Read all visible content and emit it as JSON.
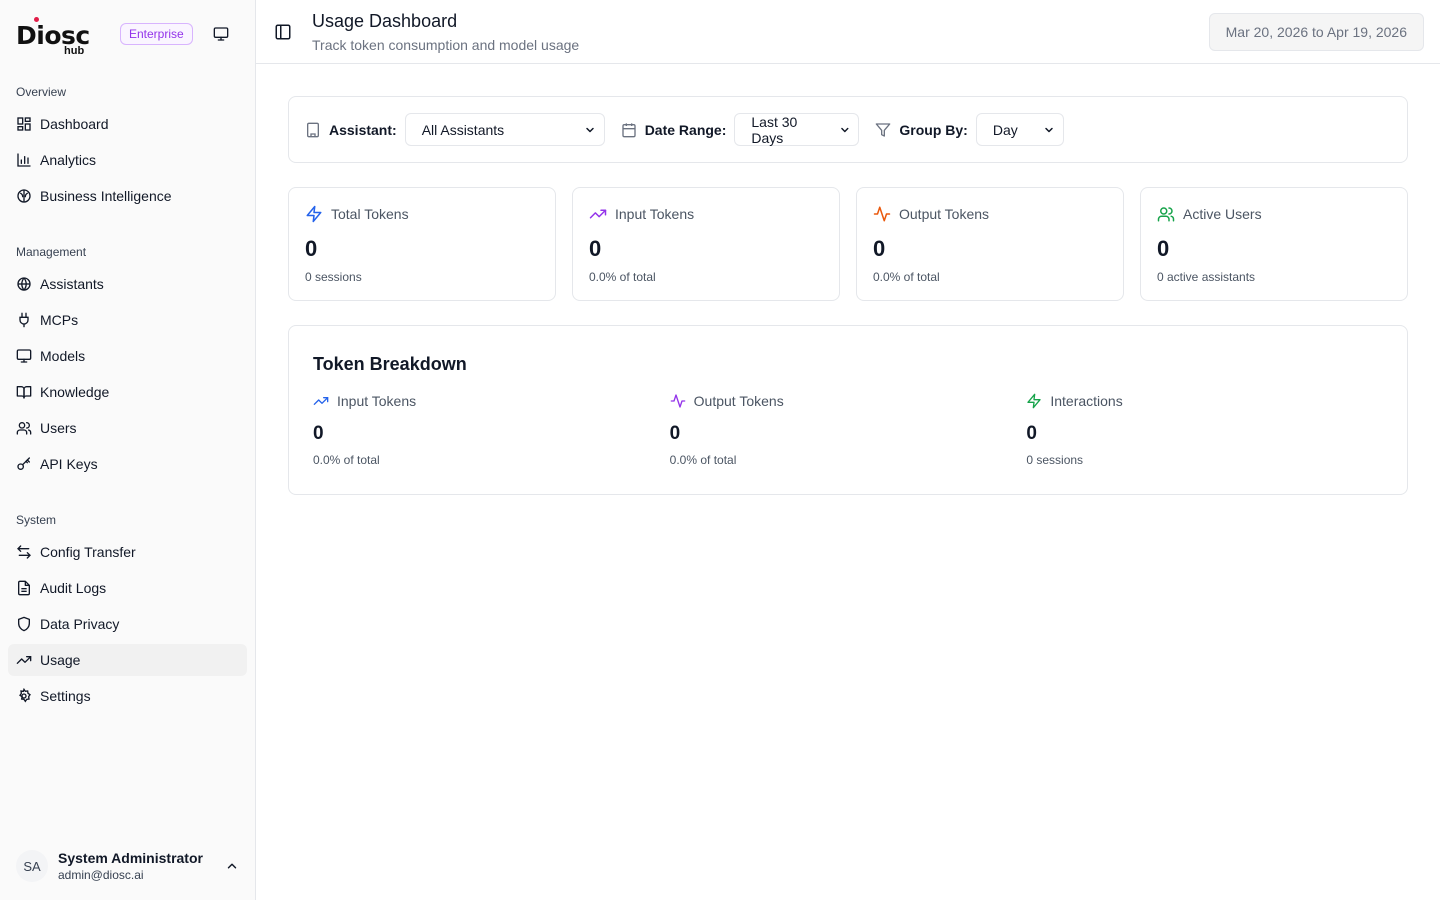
{
  "brand": {
    "logo_text": "Diosc",
    "logo_sub": "hub",
    "edition": "Enterprise"
  },
  "sidebar": {
    "sections": [
      {
        "label": "Overview",
        "items": [
          {
            "label": "Dashboard",
            "icon": "grid-icon"
          },
          {
            "label": "Analytics",
            "icon": "bar-chart-icon"
          },
          {
            "label": "Business Intelligence",
            "icon": "brain-icon"
          }
        ]
      },
      {
        "label": "Management",
        "items": [
          {
            "label": "Assistants",
            "icon": "globe-icon"
          },
          {
            "label": "MCPs",
            "icon": "plug-icon"
          },
          {
            "label": "Models",
            "icon": "monitor-icon"
          },
          {
            "label": "Knowledge",
            "icon": "book-icon"
          },
          {
            "label": "Users",
            "icon": "users-icon"
          },
          {
            "label": "API Keys",
            "icon": "key-icon"
          }
        ]
      },
      {
        "label": "System",
        "items": [
          {
            "label": "Config Transfer",
            "icon": "arrows-icon"
          },
          {
            "label": "Audit Logs",
            "icon": "file-text-icon"
          },
          {
            "label": "Data Privacy",
            "icon": "shield-icon"
          },
          {
            "label": "Usage",
            "icon": "trending-up-icon"
          },
          {
            "label": "Settings",
            "icon": "gear-icon"
          }
        ]
      }
    ],
    "active_item": "Usage"
  },
  "user": {
    "initials": "SA",
    "name": "System Administrator",
    "email": "admin@diosc.ai"
  },
  "header": {
    "title": "Usage Dashboard",
    "subtitle": "Track token consumption and model usage",
    "date_range": "Mar 20, 2026 to Apr 19, 2026"
  },
  "filters": {
    "assistant_label": "Assistant:",
    "assistant_value": "All Assistants",
    "date_label": "Date Range:",
    "date_value": "Last 30 Days",
    "group_label": "Group By:",
    "group_value": "Day"
  },
  "stats": {
    "total": {
      "label": "Total Tokens",
      "value": "0",
      "sub": "0 sessions",
      "color": "#2563eb"
    },
    "input": {
      "label": "Input Tokens",
      "value": "0",
      "sub": "0.0% of total",
      "color": "#9333ea"
    },
    "output": {
      "label": "Output Tokens",
      "value": "0",
      "sub": "0.0% of total",
      "color": "#ea580c"
    },
    "users": {
      "label": "Active Users",
      "value": "0",
      "sub": "0 active assistants",
      "color": "#16a34a"
    }
  },
  "breakdown": {
    "title": "Token Breakdown",
    "input": {
      "label": "Input Tokens",
      "value": "0",
      "sub": "0.0% of total",
      "color": "#2563eb"
    },
    "output": {
      "label": "Output Tokens",
      "value": "0",
      "sub": "0.0% of total",
      "color": "#9333ea"
    },
    "interactions": {
      "label": "Interactions",
      "value": "0",
      "sub": "0 sessions",
      "color": "#16a34a"
    }
  }
}
